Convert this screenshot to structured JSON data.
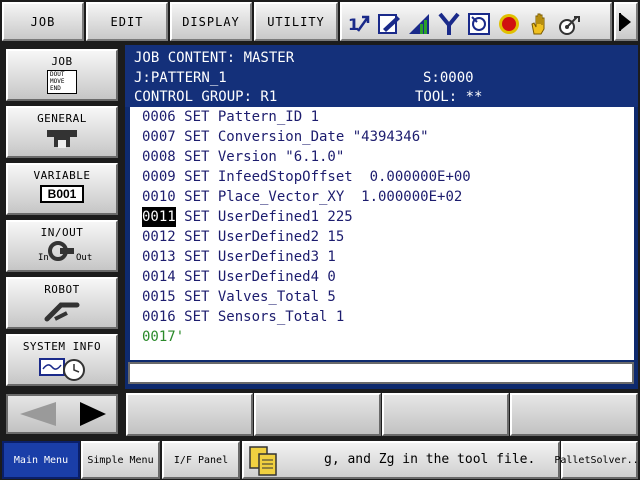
{
  "top_menu": {
    "job": "JOB",
    "edit": "EDIT",
    "display": "DISPLAY",
    "utility": "UTILITY"
  },
  "status_icons": [
    "coordinate-icon",
    "edit-mode-icon",
    "speed-icon",
    "y-icon",
    "servo-icon",
    "stop-icon",
    "hand-icon",
    "security-icon"
  ],
  "side_menu": {
    "job": {
      "label": "JOB",
      "icon_lines": [
        "DOUT",
        "MOVE",
        "END"
      ]
    },
    "general": {
      "label": "GENERAL"
    },
    "variable": {
      "label": "VARIABLE",
      "badge": "B001"
    },
    "inout": {
      "label": "IN/OUT",
      "in": "In",
      "out": "Out"
    },
    "robot": {
      "label": "ROBOT"
    },
    "system_info": {
      "label": "SYSTEM INFO"
    }
  },
  "header": {
    "title": "JOB CONTENT: MASTER",
    "job": "J:PATTERN_1",
    "step": "S:0000",
    "control_group": "CONTROL GROUP: R1",
    "tool": "TOOL: **"
  },
  "job_lines": [
    {
      "num": "0006",
      "text": " SET Pattern_ID 1"
    },
    {
      "num": "0007",
      "text": " SET Conversion_Date \"4394346\""
    },
    {
      "num": "0008",
      "text": " SET Version \"6.1.0\""
    },
    {
      "num": "0009",
      "text": " SET InfeedStopOffset  0.000000E+00"
    },
    {
      "num": "0010",
      "text": " SET Place_Vector_XY  1.000000E+02"
    },
    {
      "num": "0011",
      "text": " SET UserDefined1 225"
    },
    {
      "num": "0012",
      "text": " SET UserDefined2 15"
    },
    {
      "num": "0013",
      "text": " SET UserDefined3 1"
    },
    {
      "num": "0014",
      "text": " SET UserDefined4 0"
    },
    {
      "num": "0015",
      "text": " SET Valves_Total 5"
    },
    {
      "num": "0016",
      "text": " SET Sensors_Total 1"
    },
    {
      "num": "0017'",
      "text": ""
    }
  ],
  "input_value": "",
  "bottom": {
    "main_menu": "Main Menu",
    "simple_menu": "Simple Menu",
    "if_panel": "I/F Panel",
    "message": "g, and Zg in the tool file.     l",
    "pallet": "PalletSolver..."
  },
  "colors": {
    "header_bg": "#14307a",
    "selected_line_bg": "#000000",
    "active_menu": "#1a3ea8",
    "end_line": "#2a8a2a"
  }
}
